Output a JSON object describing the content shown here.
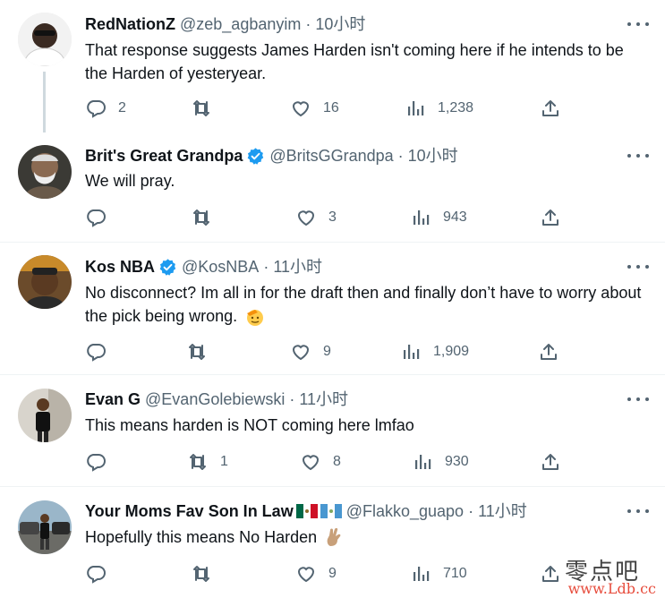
{
  "tweets": [
    {
      "name": "RedNationZ",
      "handle": "@zeb_agbanyim",
      "time": "10小时",
      "verified": false,
      "text": "That response suggests James Harden isn't coming here if he intends to be the Harden of yesteryear.",
      "replies": "2",
      "retweets": "",
      "likes": "16",
      "views": "1,238"
    },
    {
      "name": "Brit's Great Grandpa",
      "handle": "@BritsGGrandpa",
      "time": "10小时",
      "verified": true,
      "text": "We will pray.",
      "replies": "",
      "retweets": "",
      "likes": "3",
      "views": "943"
    },
    {
      "name": "Kos NBA",
      "handle": "@KosNBA",
      "time": "11小时",
      "verified": true,
      "text": "No disconnect? Im all in for the draft then and finally don’t have to worry about the pick being wrong.",
      "replies": "",
      "retweets": "",
      "likes": "9",
      "views": "1,909"
    },
    {
      "name": "Evan G",
      "handle": "@EvanGolebiewski",
      "time": "11小时",
      "verified": false,
      "text": "This means harden is NOT coming here lmfao",
      "replies": "",
      "retweets": "1",
      "likes": "8",
      "views": "930"
    },
    {
      "name": "Your Moms Fav Son In Law",
      "handle": "@Flakko_guapo",
      "time": "11小时",
      "verified": false,
      "text": "Hopefully this means No Harden",
      "replies": "",
      "retweets": "",
      "likes": "9",
      "views": "710"
    }
  ],
  "separator": "·",
  "watermark": {
    "line1": "零点吧",
    "line2": "www.Ldb.cc"
  },
  "colors": {
    "text": "#0f1419",
    "secondary": "#536471",
    "verified": "#1d9bf0",
    "divider": "#eff3f4"
  },
  "icons": [
    "reply-icon",
    "retweet-icon",
    "like-icon",
    "views-icon",
    "share-icon",
    "more-icon",
    "verified-badge-icon"
  ]
}
